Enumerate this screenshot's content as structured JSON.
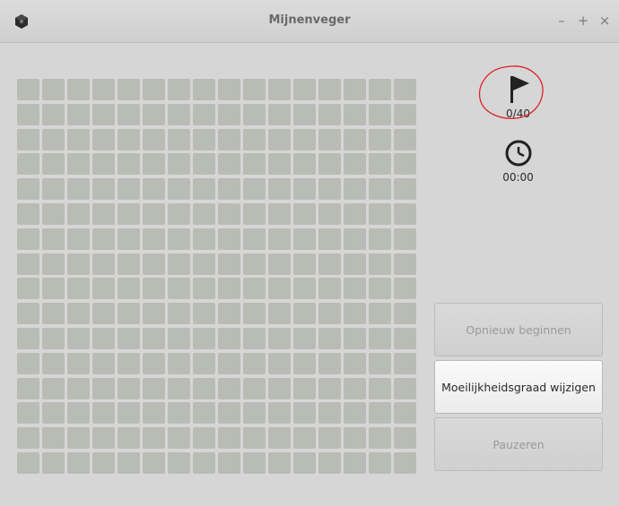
{
  "window": {
    "title": "Mijnenveger",
    "minimize_label": "–",
    "maximize_label": "+",
    "close_label": "×",
    "app_icon": "mine-icon"
  },
  "board": {
    "rows": 16,
    "columns": 16,
    "cell_state": "unrevealed",
    "cell_color": "#b9bcb5"
  },
  "status": {
    "flag_icon": "flag-icon",
    "flags_counter": "0/40",
    "clock_icon": "clock-icon",
    "elapsed_time": "00:00",
    "annotation_color": "#e0202a"
  },
  "buttons": {
    "restart": "Opnieuw beginnen",
    "change_difficulty": "Moeilijkheidsgraad wijzigen",
    "pause": "Pauzeren"
  }
}
